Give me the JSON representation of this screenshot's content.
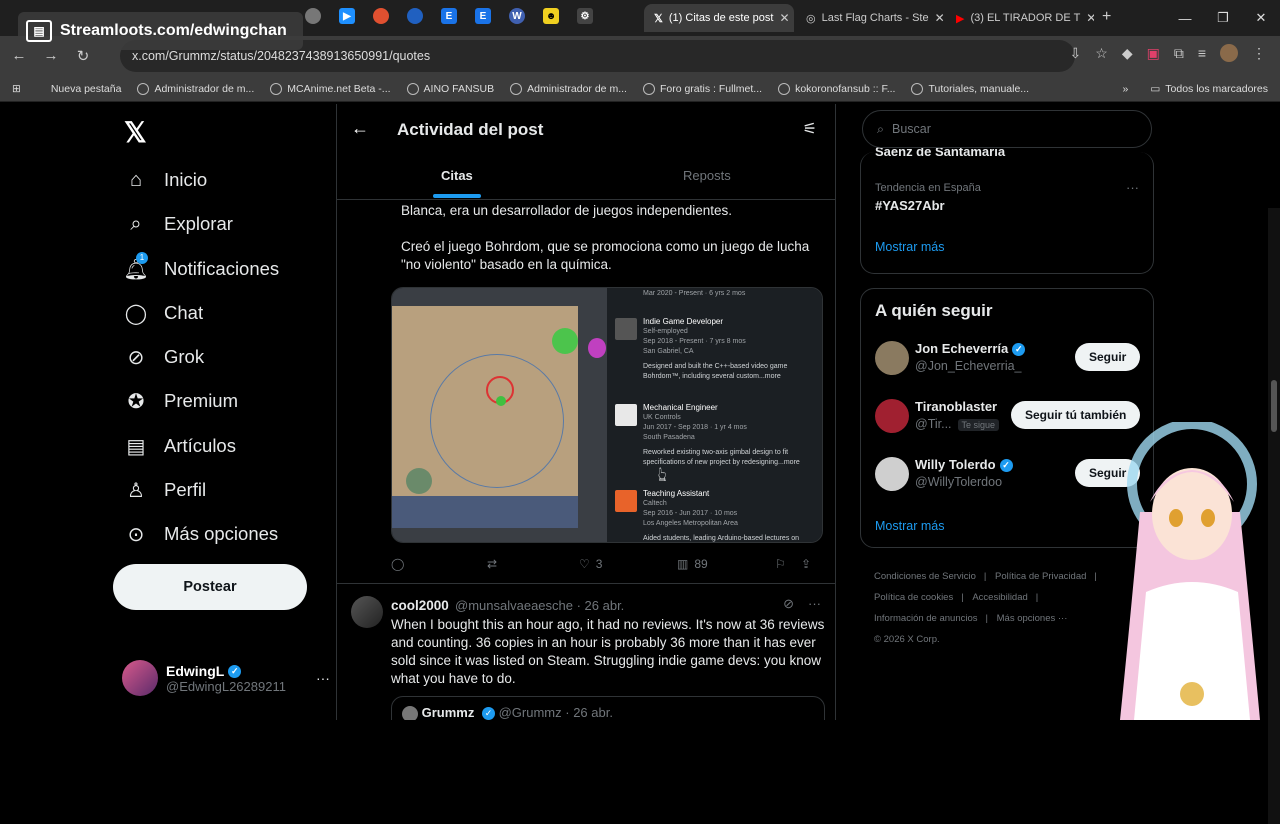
{
  "overlay": {
    "text": "Streamloots.com/edwingchan"
  },
  "browser": {
    "tabs": [
      {
        "label": "(1) Citas de este post",
        "active": true
      },
      {
        "label": "Last Flag Charts - Ste",
        "active": false
      },
      {
        "label": "(3) EL TIRADOR DE T",
        "active": false
      }
    ],
    "url": "x.com/Grummz/status/2048237438913650991/quotes",
    "bookmarks": [
      "Nueva pestaña",
      "Administrador de m...",
      "MCAnime.net Beta -...",
      "AINO FANSUB",
      "Administrador de m...",
      "Foro gratis : Fullmet...",
      "kokoronofansub :: F...",
      "Tutoriales, manuale..."
    ],
    "all_bookmarks": "Todos los marcadores"
  },
  "nav": {
    "items": [
      "Inicio",
      "Explorar",
      "Notificaciones",
      "Chat",
      "Grok",
      "Premium",
      "Artículos",
      "Perfil",
      "Más opciones"
    ],
    "notif_badge": "1",
    "post_button": "Postear",
    "account": {
      "name": "EdwingL",
      "handle": "@EdwingL26289211"
    }
  },
  "center": {
    "title": "Actividad del post",
    "tabs": [
      "Citas",
      "Reposts"
    ],
    "post_text_1": "Blanca, era un desarrollador de juegos independientes.",
    "post_text_2": "Creó el juego Bohrdom, que se promociona como un juego de lucha \"no violento\" basado en la química.",
    "media": {
      "header": "Mar 2020 - Present · 6 yrs 2 mos",
      "jobs": [
        {
          "title": "Indie Game Developer",
          "org": "Self-employed",
          "dates": "Sep 2018 - Present · 7 yrs 8 mos",
          "loc": "San Gabriel, CA",
          "desc": "Designed and built the C++-based video game Bohrdom™, including several custom...more"
        },
        {
          "title": "Mechanical Engineer",
          "org": "UK Controls",
          "dates": "Jun 2017 - Sep 2018 · 1 yr 4 mos",
          "loc": "South Pasadena",
          "desc": "Reworked existing two-axis gimbal design to fit specifications of new project by redesigning...more"
        },
        {
          "title": "Teaching Assistant",
          "org": "Caltech",
          "dates": "Sep 2016 - Jun 2017 · 10 mos",
          "loc": "Los Angeles Metropolitan Area",
          "desc": "Aided students, leading Arduino-based lectures on"
        }
      ]
    },
    "actions": {
      "replies": "",
      "reposts": "",
      "likes": "3",
      "views": "89"
    },
    "reply": {
      "name": "cool2000",
      "handle": "@munsalvaeaesche · 26 abr.",
      "text": "When I bought this an hour ago, it had no reviews. It's now at 36 reviews and counting. 36 copies in an hour is probably 36 more than it has ever sold since it was listed on Steam. Struggling indie game devs: you know what you have to do.",
      "quote_name": "Grummz",
      "quote_handle": "@Grummz · 26 abr."
    }
  },
  "right": {
    "search_placeholder": "Buscar",
    "cut_text": "Saenz de Santamaria",
    "trend_category": "Tendencia en España",
    "trend_name": "#YAS27Abr",
    "show_more": "Mostrar más",
    "who_title": "A quién seguir",
    "users": [
      {
        "name": "Jon Echeverría",
        "handle": "@Jon_Echeverria_",
        "button": "Seguir",
        "verified": true
      },
      {
        "name": "Tiranoblaster",
        "handle": "@Tir...",
        "button": "Seguir tú también",
        "follows_you": "Te sigue",
        "verified": false
      },
      {
        "name": "Willy Tolerdo",
        "handle": "@WillyTolerdoo",
        "button": "Seguir",
        "verified": true
      }
    ],
    "show_more_2": "Mostrar más",
    "footer": [
      "Condiciones de Servicio",
      "Política de Privacidad",
      "Política de cookies",
      "Accesibilidad",
      "Información de anuncios",
      "Más opciones ···",
      "© 2026 X Corp."
    ]
  }
}
